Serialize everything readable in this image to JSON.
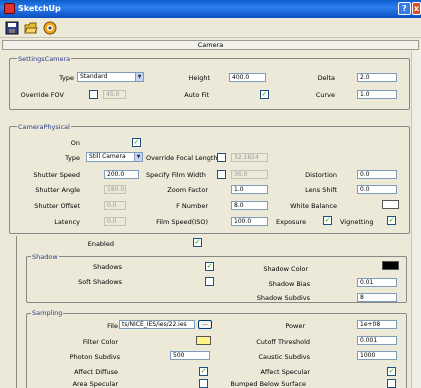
{
  "window": {
    "title": "SketchUp",
    "help": "?",
    "close": "x"
  },
  "toolbar": {
    "icons": [
      "save-icon",
      "folder-icon",
      "render-icon"
    ]
  },
  "camera_header": "Camera",
  "settings_camera": {
    "legend": "SettingsCamera",
    "type_label": "Type",
    "type_value": "Standard",
    "height_label": "Height",
    "height_value": "400.0",
    "delta_label": "Delta",
    "delta_value": "2.0",
    "override_fov_label": "Override FOV",
    "override_fov_value": "45.0",
    "autofit_label": "Auto Fit",
    "curve_label": "Curve",
    "curve_value": "1.0"
  },
  "camera_physical": {
    "legend": "CameraPhysical",
    "on_label": "On",
    "type_label": "Type",
    "type_value": "Still Camera",
    "override_focal_label": "Override Focal Length",
    "override_focal_value": "32.1824",
    "shutter_speed_label": "Shutter Speed",
    "shutter_speed_value": "200.0",
    "specify_film_label": "Specify Film Width",
    "specify_film_value": "36.0",
    "distortion_label": "Distortion",
    "distortion_value": "0.0",
    "shutter_angle_label": "Shutter Angle",
    "shutter_angle_value": "180.0",
    "zoom_label": "Zoom Factor",
    "zoom_value": "1.0",
    "lens_shift_label": "Lens Shift",
    "lens_shift_value": "0.0",
    "shutter_offset_label": "Shutter Offset",
    "shutter_offset_value": "0.0",
    "fnumber_label": "F Number",
    "fnumber_value": "8.0",
    "white_balance_label": "White Balance",
    "latency_label": "Latency",
    "latency_value": "0.0",
    "film_speed_label": "Film Speed(ISO)",
    "film_speed_value": "100.0",
    "exposure_label": "Exposure",
    "vignetting_label": "Vignetting"
  },
  "enabled_label": "Enabled",
  "shadow": {
    "legend": "Shadow",
    "shadows_label": "Shadows",
    "shadow_color_label": "Shadow Color",
    "soft_shadows_label": "Soft Shadows",
    "shadow_bias_label": "Shadow Bias",
    "shadow_bias_value": "0.01",
    "shadow_subdivs_label": "Shadow Subdivs",
    "shadow_subdivs_value": "8"
  },
  "sampling": {
    "legend": "Sampling",
    "file_label": "File",
    "file_value": "ts/NICE_IES/ies/22.ies",
    "browse": "...",
    "power_label": "Power",
    "power_value": "1e+08",
    "filter_color_label": "Filter Color",
    "cutoff_label": "Cutoff Threshold",
    "cutoff_value": "0.001",
    "photon_subdivs_label": "Photon Subdivs",
    "photon_subdivs_value": "500",
    "caustic_subdivs_label": "Caustic Subdivs",
    "caustic_subdivs_value": "1000",
    "affect_diffuse_label": "Affect Diffuse",
    "affect_specular_label": "Affect Specular",
    "area_specular_label": "Area Specular",
    "bumped_below_label": "Bumped Below Surface"
  },
  "colors": {
    "shadow_color": "#000000",
    "filter_color": "#fff38a",
    "white_balance": "#ffffff",
    "title_bar": "#0a5ec9"
  }
}
